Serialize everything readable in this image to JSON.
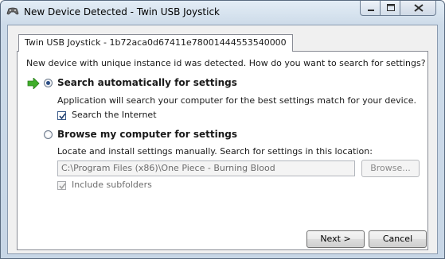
{
  "window": {
    "title": "New Device Detected - Twin USB Joystick",
    "app_icon": "gamepad-icon",
    "controls": [
      "minimize-icon",
      "maximize-icon",
      "close-icon"
    ]
  },
  "tab": {
    "label": "Twin USB Joystick - 1b72aca0d67411e78001444553540000"
  },
  "panel": {
    "intro": "New device with unique instance id was detected. How do you want to search for settings?",
    "auto": {
      "title": "Search automatically for settings",
      "description": "Application will search your computer for the best settings match for your device.",
      "selected": true,
      "search_internet_label": "Search the Internet",
      "search_internet_checked": true
    },
    "browse": {
      "title": "Browse my computer for settings",
      "description": "Locate and install settings manually. Search for settings in this location:",
      "selected": false,
      "path_value": "C:\\Program Files (x86)\\One Piece - Burning Blood",
      "browse_button": "Browse...",
      "include_subfolders_label": "Include subfolders",
      "include_subfolders_checked": true,
      "enabled": false
    }
  },
  "footer": {
    "next_label": "Next >",
    "cancel_label": "Cancel"
  },
  "colors": {
    "arrow": "#3fae2a",
    "title_bar": "#cddbe9"
  }
}
